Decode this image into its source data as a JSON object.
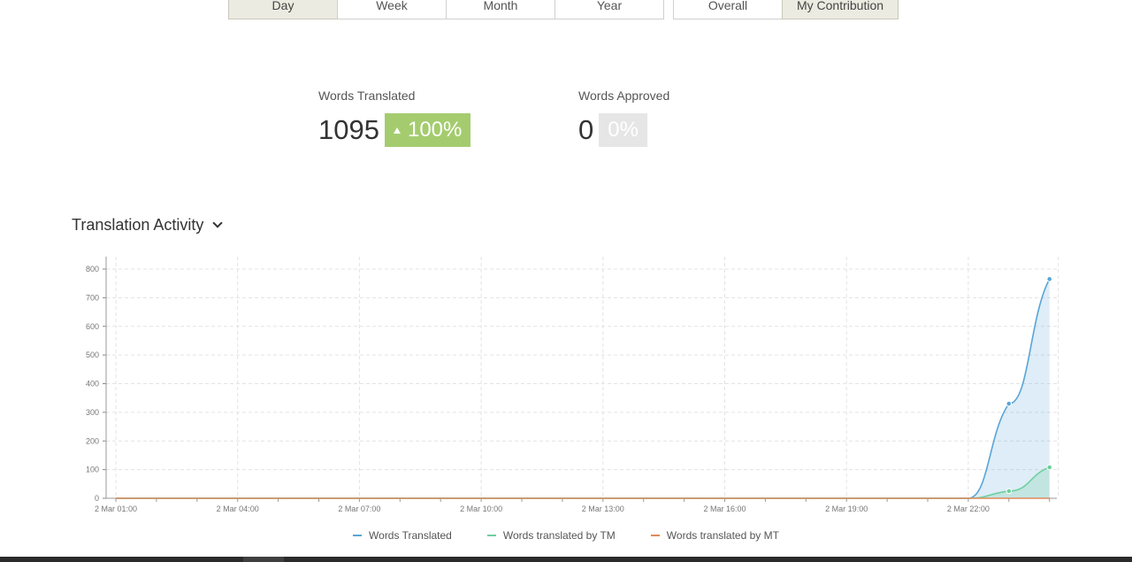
{
  "filters": {
    "time": [
      {
        "label": "Day",
        "active": true
      },
      {
        "label": "Week",
        "active": false
      },
      {
        "label": "Month",
        "active": false
      },
      {
        "label": "Year",
        "active": false
      }
    ],
    "scope": [
      {
        "label": "Overall",
        "active": false
      },
      {
        "label": "My Contribution",
        "active": true
      }
    ]
  },
  "stats": {
    "words_translated": {
      "label": "Words Translated",
      "value": "1095",
      "change": "100%"
    },
    "words_approved": {
      "label": "Words Approved",
      "value": "0",
      "change": "0%"
    }
  },
  "section": {
    "title": "Translation Activity"
  },
  "colors": {
    "translated": "#5aa5d6",
    "tm": "#6fcf9f",
    "mt": "#e08a5a",
    "badge_up": "#a4cc6e",
    "badge_neutral": "#e6e6e6"
  },
  "chart_data": {
    "type": "area",
    "x": [
      "2 Mar 01:00",
      "2 Mar 02:00",
      "2 Mar 03:00",
      "2 Mar 04:00",
      "2 Mar 05:00",
      "2 Mar 06:00",
      "2 Mar 07:00",
      "2 Mar 08:00",
      "2 Mar 09:00",
      "2 Mar 10:00",
      "2 Mar 11:00",
      "2 Mar 12:00",
      "2 Mar 13:00",
      "2 Mar 14:00",
      "2 Mar 15:00",
      "2 Mar 16:00",
      "2 Mar 17:00",
      "2 Mar 18:00",
      "2 Mar 19:00",
      "2 Mar 20:00",
      "2 Mar 21:00",
      "2 Mar 22:00",
      "2 Mar 23:00",
      "3 Mar 00:00"
    ],
    "xticks": [
      "2 Mar 01:00",
      "2 Mar 04:00",
      "2 Mar 07:00",
      "2 Mar 10:00",
      "2 Mar 13:00",
      "2 Mar 16:00",
      "2 Mar 19:00",
      "2 Mar 22:00"
    ],
    "ylim": [
      0,
      800
    ],
    "yticks": [
      0,
      100,
      200,
      300,
      400,
      500,
      600,
      700,
      800
    ],
    "grid": true,
    "legend": "bottom-center",
    "series": [
      {
        "name": "Words Translated",
        "values": [
          0,
          0,
          0,
          0,
          0,
          0,
          0,
          0,
          0,
          0,
          0,
          0,
          0,
          0,
          0,
          0,
          0,
          0,
          0,
          0,
          0,
          0,
          330,
          765
        ]
      },
      {
        "name": "Words translated by TM",
        "values": [
          0,
          0,
          0,
          0,
          0,
          0,
          0,
          0,
          0,
          0,
          0,
          0,
          0,
          0,
          0,
          0,
          0,
          0,
          0,
          0,
          0,
          0,
          25,
          108
        ]
      },
      {
        "name": "Words translated by MT",
        "values": [
          0,
          0,
          0,
          0,
          0,
          0,
          0,
          0,
          0,
          0,
          0,
          0,
          0,
          0,
          0,
          0,
          0,
          0,
          0,
          0,
          0,
          0,
          0,
          0
        ]
      }
    ]
  }
}
